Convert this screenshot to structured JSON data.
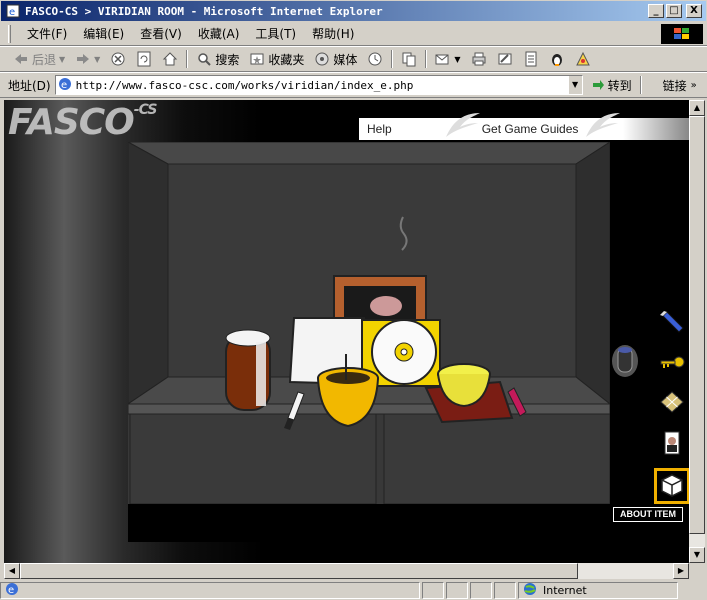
{
  "window": {
    "title": "FASCO-CS > VIRIDIAN ROOM - Microsoft Internet Explorer",
    "min": "_",
    "max": "□",
    "close": "X"
  },
  "menu": [
    "文件(F)",
    "编辑(E)",
    "查看(V)",
    "收藏(A)",
    "工具(T)",
    "帮助(H)"
  ],
  "toolbar": {
    "back": "后退",
    "search": "搜索",
    "favorites": "收藏夹",
    "media": "媒体"
  },
  "address": {
    "label": "地址(D)",
    "url": "http://www.fasco-csc.com/works/viridian/index_e.php",
    "go": "转到",
    "links": "链接"
  },
  "page": {
    "logo": "FASCO",
    "logo_suffix": "-CS",
    "nav": [
      "Help",
      "Get Game Guides"
    ],
    "about_button": "ABOUT ITEM",
    "inventory": [
      "flashlight-icon",
      "key-icon",
      "tile-icon",
      "photo-icon",
      "cube-icon"
    ],
    "held_item": "can-icon"
  },
  "status": {
    "zone": "Internet"
  },
  "colors": {
    "titlebar": "#0a246a",
    "selected_slot": "#f0b000"
  }
}
